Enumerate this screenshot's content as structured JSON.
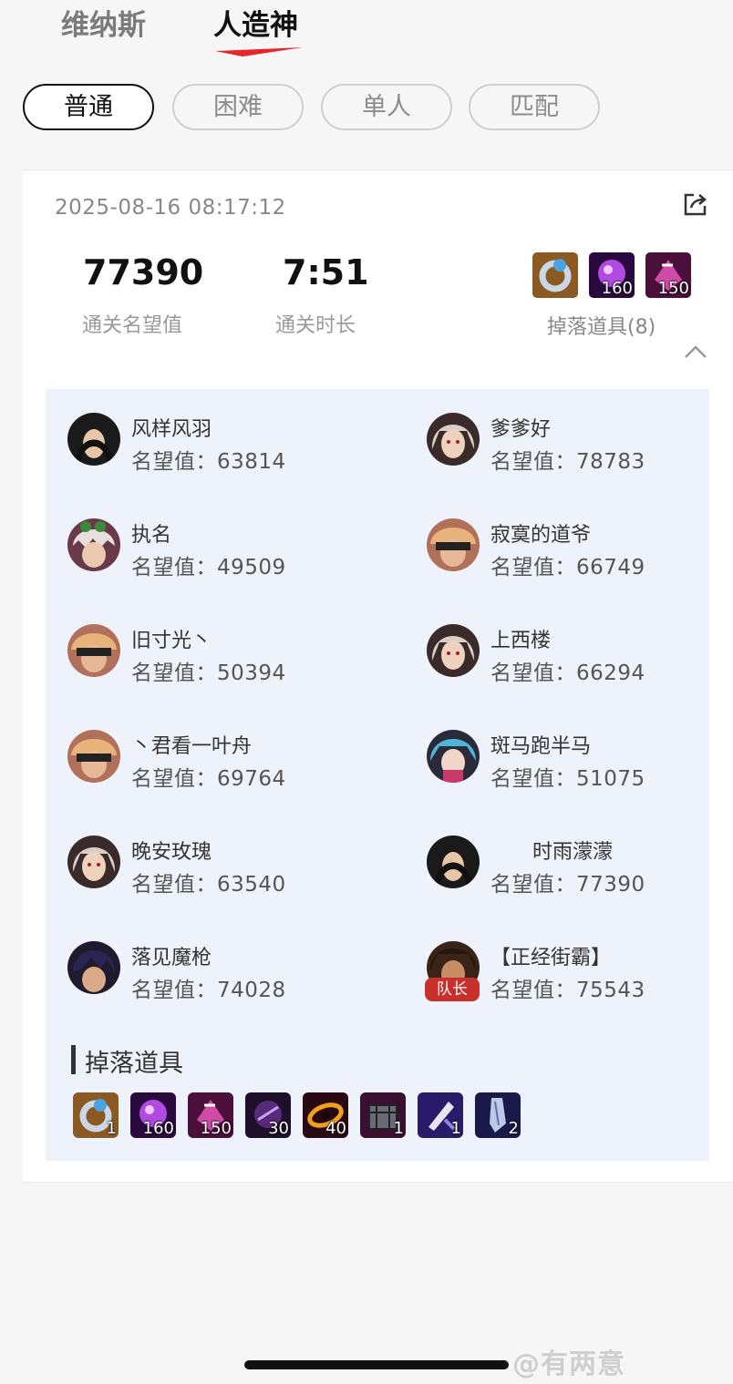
{
  "top_tabs": [
    {
      "label": "维纳斯",
      "active": false
    },
    {
      "label": "人造神",
      "active": true
    }
  ],
  "difficulty": [
    {
      "label": "普通",
      "active": true
    },
    {
      "label": "困难",
      "active": false
    },
    {
      "label": "单人",
      "active": false
    },
    {
      "label": "匹配",
      "active": false
    }
  ],
  "record": {
    "timestamp": "2025-08-16 08:17:12",
    "fame_value": "77390",
    "fame_label": "通关名望值",
    "duration_value": "7:51",
    "duration_label": "通关时长",
    "drops_label": "掉落道具(8)",
    "preview_items": [
      {
        "icon": "ring-icon",
        "count": ""
      },
      {
        "icon": "purple-orb-icon",
        "count": "160"
      },
      {
        "icon": "purple-crystal-icon",
        "count": "150"
      }
    ]
  },
  "players": [
    {
      "name": "风样风羽",
      "score": "名望值：63814",
      "avatar": "dark-hair-female-avatar"
    },
    {
      "name": "爹爹好",
      "score": "名望值：78783",
      "avatar": "white-hair-female-avatar"
    },
    {
      "name": "执名",
      "score": "名望值：49509",
      "avatar": "white-hair-goggles-avatar"
    },
    {
      "name": "寂寞的道爷",
      "score": "名望值：66749",
      "avatar": "blindfold-male-avatar"
    },
    {
      "name": "旧寸光丶",
      "score": "名望值：50394",
      "avatar": "blindfold-male-avatar"
    },
    {
      "name": "上西楼",
      "score": "名望值：66294",
      "avatar": "white-hair-female-avatar"
    },
    {
      "name": "丶君看一叶舟",
      "score": "名望值：69764",
      "avatar": "blindfold-male-avatar"
    },
    {
      "name": "斑马跑半马",
      "score": "名望值：51075",
      "avatar": "blue-hair-female-avatar"
    },
    {
      "name": "晚安玫瑰",
      "score": "名望值：63540",
      "avatar": "white-hair-female-avatar"
    },
    {
      "name": "时雨濛濛",
      "score": "名望值：77390",
      "avatar": "dark-hair-female-avatar"
    },
    {
      "name": "落见魔枪",
      "score": "名望值：74028",
      "avatar": "dark-hair-male-avatar"
    },
    {
      "name": "【正经街霸】",
      "score": "名望值：75543",
      "avatar": "brawler-male-avatar",
      "badge": "队长"
    }
  ],
  "drops": {
    "title": "掉落道具",
    "items": [
      {
        "icon": "ring-icon",
        "count": "1"
      },
      {
        "icon": "purple-orb-icon",
        "count": "160"
      },
      {
        "icon": "purple-crystal-icon",
        "count": "150"
      },
      {
        "icon": "dark-orb-icon",
        "count": "30"
      },
      {
        "icon": "flame-vortex-icon",
        "count": "40"
      },
      {
        "icon": "treasure-box-icon",
        "count": "1"
      },
      {
        "icon": "scroll-icon",
        "count": "1"
      },
      {
        "icon": "spike-shard-icon",
        "count": "2"
      }
    ]
  },
  "watermark": "@有两意",
  "colors": {
    "accent": "#e8262a",
    "panel_bg": "#eef2fa",
    "captain_badge": "#c9302c"
  }
}
